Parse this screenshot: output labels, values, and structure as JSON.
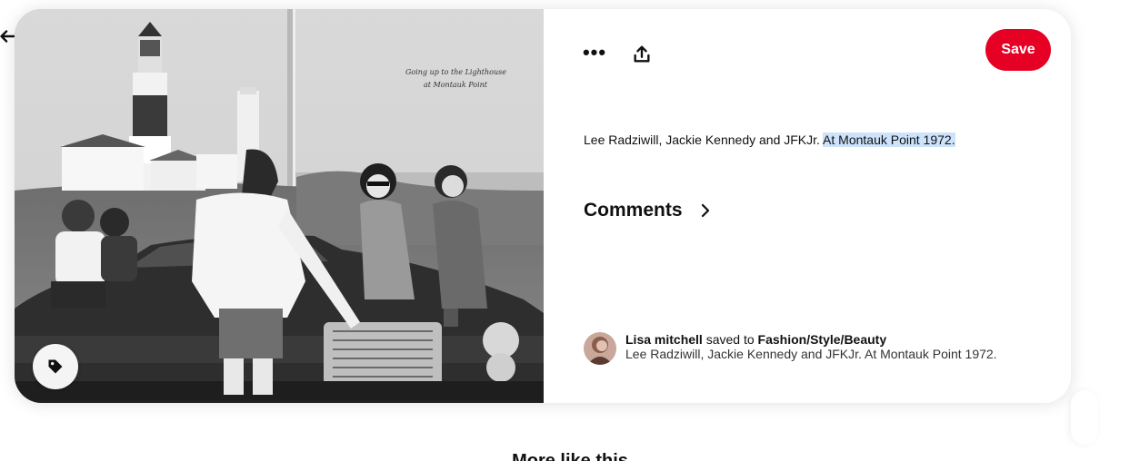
{
  "pin": {
    "description_plain": "Lee Radziwill, Jackie Kennedy and JFKJr.",
    "description_highlight": "At Montauk Point 1972.",
    "photo_caption_handwriting": "Going up to the Lighthouse at Montauk Point"
  },
  "toolbar": {
    "more_label": "•••",
    "save_label": "Save"
  },
  "comments": {
    "title": "Comments"
  },
  "saver": {
    "name": "Lisa mitchell",
    "action": "saved to",
    "board": "Fashion/Style/Beauty",
    "description": "Lee Radziwill, Jackie Kennedy and JFKJr. At Montauk Point 1972."
  },
  "more_like_this": {
    "title": "More like this"
  },
  "icons": [
    "back-arrow-icon",
    "more-icon",
    "share-icon",
    "tag-icon",
    "chevron-right-icon"
  ],
  "colors": {
    "save_button": "#e60023",
    "highlight": "#cde3fb"
  }
}
